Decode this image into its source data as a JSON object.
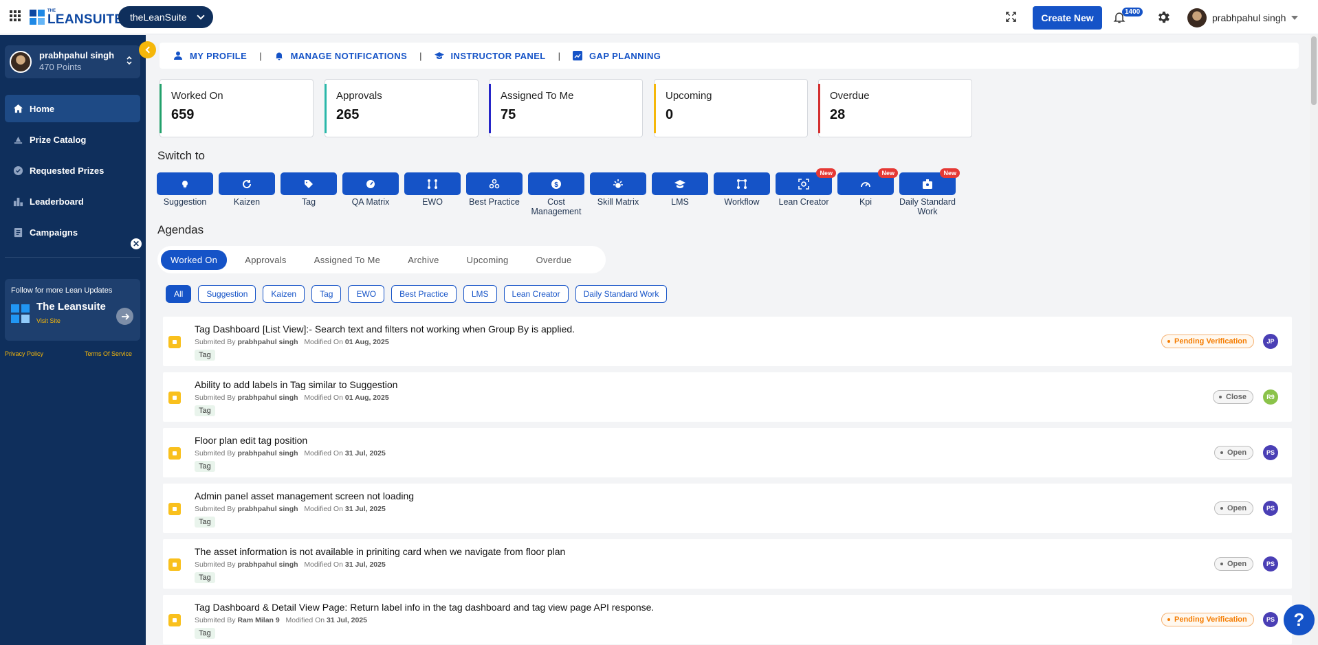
{
  "topbar": {
    "logo_small": "THE",
    "logo_text": "LEANSUITE",
    "org_select": "theLeanSuite",
    "create_new": "Create New",
    "notification_count": "1400",
    "username": "prabhpahul singh"
  },
  "sidebar": {
    "profile_name": "prabhpahul singh",
    "profile_points": "470 Points",
    "items": [
      {
        "label": "Home",
        "icon": "home-icon"
      },
      {
        "label": "Prize Catalog",
        "icon": "prize-icon"
      },
      {
        "label": "Requested Prizes",
        "icon": "requested-icon"
      },
      {
        "label": "Leaderboard",
        "icon": "leaderboard-icon"
      },
      {
        "label": "Campaigns",
        "icon": "campaigns-icon"
      }
    ],
    "follow_title": "Follow for more Lean Updates",
    "brand_name": "The Leansuite",
    "visit_site": "Visit Site",
    "privacy": "Privacy Policy",
    "terms": "Terms Of Service"
  },
  "profile_nav": [
    {
      "label": "MY PROFILE",
      "icon": "person-icon"
    },
    {
      "label": "MANAGE NOTIFICATIONS",
      "icon": "bell-icon"
    },
    {
      "label": "INSTRUCTOR PANEL",
      "icon": "graduation-cap-icon"
    },
    {
      "label": "GAP PLANNING",
      "icon": "chart-icon"
    }
  ],
  "stats": [
    {
      "label": "Worked On",
      "value": "659",
      "color": "#22a06b"
    },
    {
      "label": "Approvals",
      "value": "265",
      "color": "#2ab7a9"
    },
    {
      "label": "Assigned To Me",
      "value": "75",
      "color": "#2525c8"
    },
    {
      "label": "Upcoming",
      "value": "0",
      "color": "#f5b70a"
    },
    {
      "label": "Overdue",
      "value": "28",
      "color": "#d32f2f"
    }
  ],
  "switch_title": "Switch to",
  "modules": [
    {
      "label": "Suggestion",
      "icon": "bulb-icon"
    },
    {
      "label": "Kaizen",
      "icon": "cycle-icon"
    },
    {
      "label": "Tag",
      "icon": "tag-icon"
    },
    {
      "label": "QA Matrix",
      "icon": "gauge-icon"
    },
    {
      "label": "EWO",
      "icon": "nodes-icon"
    },
    {
      "label": "Best Practice",
      "icon": "network-icon"
    },
    {
      "label": "Cost Management",
      "icon": "dollar-icon"
    },
    {
      "label": "Skill Matrix",
      "icon": "spark-icon"
    },
    {
      "label": "LMS",
      "icon": "cap-icon"
    },
    {
      "label": "Workflow",
      "icon": "workflow-icon"
    },
    {
      "label": "Lean Creator",
      "icon": "scan-icon",
      "badge": "New"
    },
    {
      "label": "Kpi",
      "icon": "speedometer-icon",
      "badge": "New"
    },
    {
      "label": "Daily Standard Work",
      "icon": "badge-icon",
      "badge": "New"
    }
  ],
  "agendas_title": "Agendas",
  "agenda_tabs": [
    "Worked On",
    "Approvals",
    "Assigned To Me",
    "Archive",
    "Upcoming",
    "Overdue"
  ],
  "filter_chips": [
    "All",
    "Suggestion",
    "Kaizen",
    "Tag",
    "EWO",
    "Best Practice",
    "LMS",
    "Lean Creator",
    "Daily Standard Work"
  ],
  "rows": [
    {
      "title": "Tag Dashboard [List View]:- Search text and filters not working when Group By is applied.",
      "submitted_label": "Submited By",
      "submitter": "prabhpahul singh",
      "modified_label": "Modified On",
      "date": "01 Aug, 2025",
      "tag": "Tag",
      "status": "Pending Verification",
      "initials": "JP",
      "initials_color": "#4a3fb5"
    },
    {
      "title": "Ability to add labels in Tag similar to Suggestion",
      "submitted_label": "Submited By",
      "submitter": "prabhpahul singh",
      "modified_label": "Modified On",
      "date": "01 Aug, 2025",
      "tag": "Tag",
      "status": "Close",
      "initials": "R9",
      "initials_color": "#8bc34a"
    },
    {
      "title": "Floor plan edit tag position",
      "submitted_label": "Submited By",
      "submitter": "prabhpahul singh",
      "modified_label": "Modified On",
      "date": "31 Jul, 2025",
      "tag": "Tag",
      "status": "Open",
      "initials": "PS",
      "initials_color": "#4a3fb5"
    },
    {
      "title": "Admin panel asset management screen not loading",
      "submitted_label": "Submited By",
      "submitter": "prabhpahul singh",
      "modified_label": "Modified On",
      "date": "31 Jul, 2025",
      "tag": "Tag",
      "status": "Open",
      "initials": "PS",
      "initials_color": "#4a3fb5"
    },
    {
      "title": "The asset information is not available in priniting card when we navigate from floor plan",
      "submitted_label": "Submited By",
      "submitter": "prabhpahul singh",
      "modified_label": "Modified On",
      "date": "31 Jul, 2025",
      "tag": "Tag",
      "status": "Open",
      "initials": "PS",
      "initials_color": "#4a3fb5"
    },
    {
      "title": "Tag Dashboard & Detail View Page: Return label info in the tag dashboard and tag view page API response.",
      "submitted_label": "Submited By",
      "submitter": "Ram Milan 9",
      "modified_label": "Modified On",
      "date": "31 Jul, 2025",
      "tag": "Tag",
      "status": "Pending Verification",
      "initials": "PS",
      "initials_color": "#4a3fb5"
    }
  ],
  "help_label": "?"
}
